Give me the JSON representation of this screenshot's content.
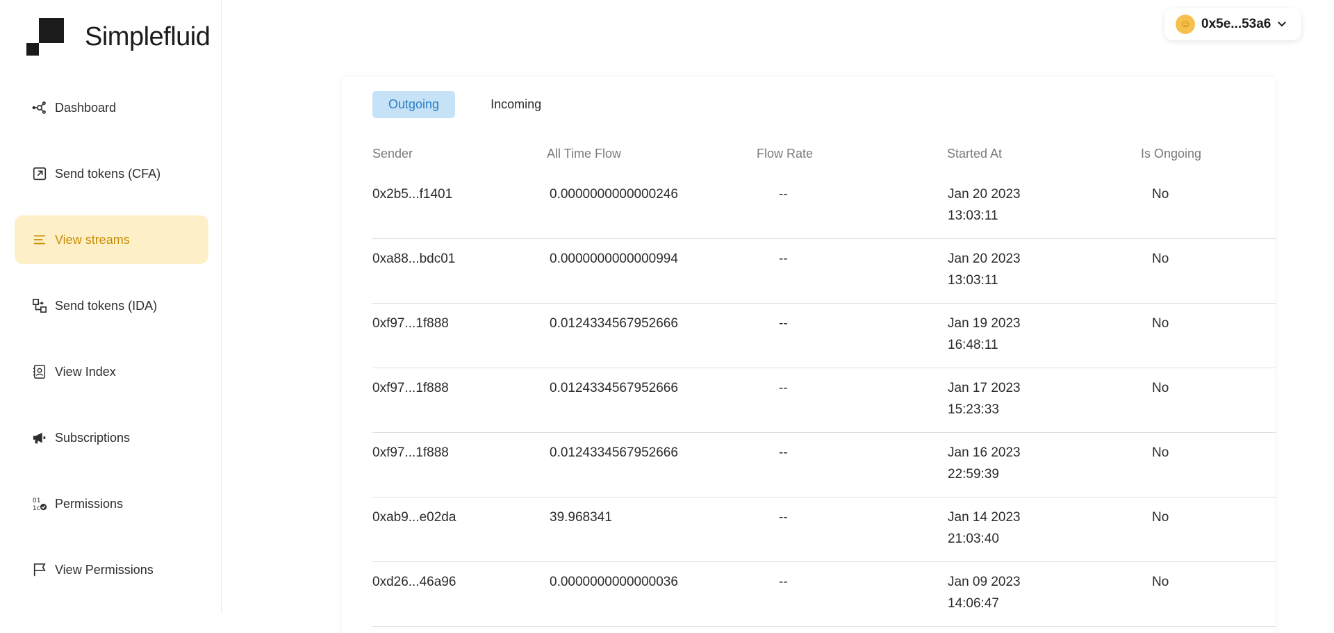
{
  "brand": {
    "name": "Simplefluid"
  },
  "sidebar": {
    "items": [
      {
        "label": "Dashboard",
        "icon": "network-icon",
        "active": false
      },
      {
        "label": "Send tokens (CFA)",
        "icon": "external-link-icon",
        "active": false
      },
      {
        "label": "View streams",
        "icon": "list-icon",
        "active": true
      },
      {
        "label": "Send tokens (IDA)",
        "icon": "distribute-icon",
        "active": false
      },
      {
        "label": "View Index",
        "icon": "contact-card-icon",
        "active": false
      },
      {
        "label": "Subscriptions",
        "icon": "megaphone-icon",
        "active": false
      },
      {
        "label": "Permissions",
        "icon": "permissions-icon",
        "active": false
      },
      {
        "label": "View Permissions",
        "icon": "flag-icon",
        "active": false
      }
    ]
  },
  "wallet": {
    "address": "0x5e...53a6"
  },
  "tabs": [
    {
      "label": "Outgoing",
      "active": true
    },
    {
      "label": "Incoming",
      "active": false
    }
  ],
  "table": {
    "headers": [
      "Sender",
      "All Time Flow",
      "Flow Rate",
      "Started At",
      "Is Ongoing"
    ],
    "rows": [
      {
        "sender": "0x2b5...f1401",
        "flow": "0.0000000000000246",
        "rate": "--",
        "date": "Jan 20 2023",
        "time": "13:03:11",
        "ongoing": "No"
      },
      {
        "sender": "0xa88...bdc01",
        "flow": "0.0000000000000994",
        "rate": "--",
        "date": "Jan 20 2023",
        "time": "13:03:11",
        "ongoing": "No"
      },
      {
        "sender": "0xf97...1f888",
        "flow": "0.0124334567952666",
        "rate": "--",
        "date": "Jan 19 2023",
        "time": "16:48:11",
        "ongoing": "No"
      },
      {
        "sender": "0xf97...1f888",
        "flow": "0.0124334567952666",
        "rate": "--",
        "date": "Jan 17 2023",
        "time": "15:23:33",
        "ongoing": "No"
      },
      {
        "sender": "0xf97...1f888",
        "flow": "0.0124334567952666",
        "rate": "--",
        "date": "Jan 16 2023",
        "time": "22:59:39",
        "ongoing": "No"
      },
      {
        "sender": "0xab9...e02da",
        "flow": "39.968341",
        "rate": "--",
        "date": "Jan 14 2023",
        "time": "21:03:40",
        "ongoing": "No"
      },
      {
        "sender": "0xd26...46a96",
        "flow": "0.0000000000000036",
        "rate": "--",
        "date": "Jan 09 2023",
        "time": "14:06:47",
        "ongoing": "No"
      }
    ]
  },
  "colors": {
    "active_nav_bg": "#fdf0c9",
    "active_nav_text": "#c98b00",
    "active_tab_bg": "#c6e2f7",
    "active_tab_text": "#2c7fc4"
  }
}
